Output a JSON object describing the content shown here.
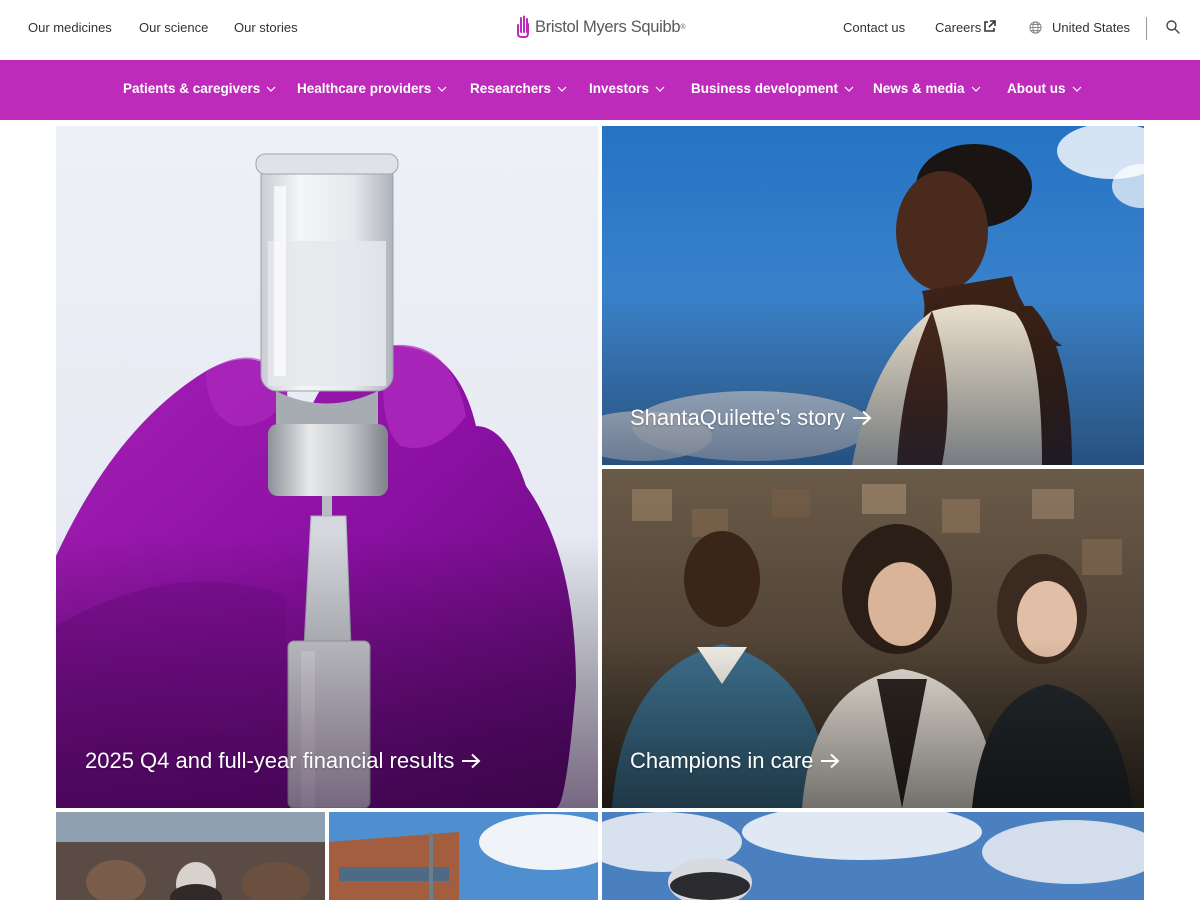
{
  "topbar": {
    "left_links": [
      "Our medicines",
      "Our science",
      "Our stories"
    ],
    "brand": "Bristol Myers Squibb",
    "brand_mark": "®",
    "contact": "Contact us",
    "careers": "Careers",
    "region": "United States"
  },
  "nav": {
    "items": [
      "Patients & caregivers",
      "Healthcare providers",
      "Researchers",
      "Investors",
      "Business development",
      "News & media",
      "About us"
    ]
  },
  "tiles": {
    "financial": "2025 Q4 and full-year financial results",
    "story": "ShantaQuilette’s story",
    "champions": "Champions in care"
  },
  "colors": {
    "brand_purple": "#be2bbb",
    "logo_purple": "#be2bbb"
  },
  "icons": [
    "external-link-icon",
    "globe-icon",
    "search-icon",
    "chevron-down-icon",
    "arrow-right-icon"
  ]
}
